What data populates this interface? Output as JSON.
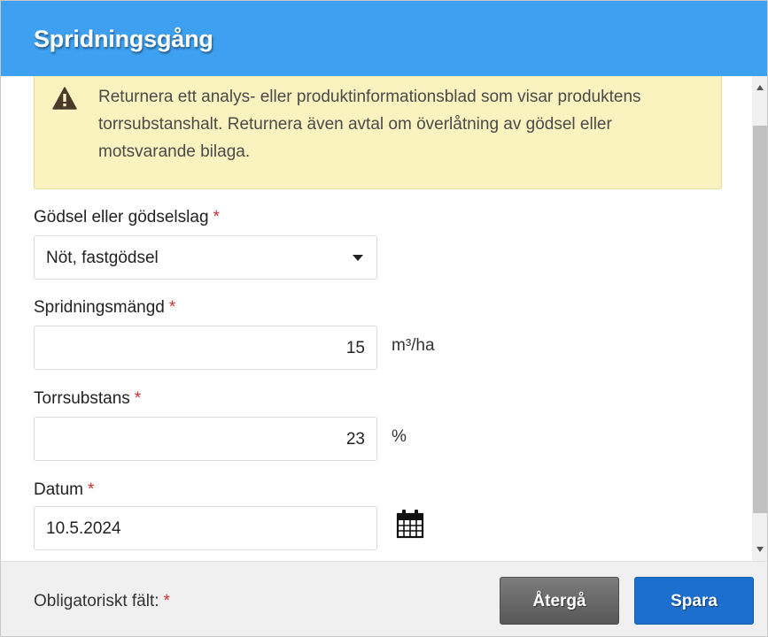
{
  "dialog": {
    "title": "Spridningsgång"
  },
  "warning": {
    "icon": "warning-triangle-icon",
    "text": "Returnera ett analys- eller produktinformationsblad som visar produktens torrsubstanshalt. Returnera även avtal om överlåtning av gödsel eller motsvarande bilaga."
  },
  "fields": {
    "manure_type": {
      "label": "Gödsel eller gödselslag",
      "required_mark": "*",
      "value": "Nöt, fastgödsel"
    },
    "spread_amount": {
      "label": "Spridningsmängd",
      "required_mark": "*",
      "value": "15",
      "unit": "m³/ha"
    },
    "dry_matter": {
      "label": "Torrsubstans",
      "required_mark": "*",
      "value": "23",
      "unit": "%"
    },
    "date": {
      "label": "Datum",
      "required_mark": "*",
      "value": "10.5.2024",
      "icon": "calendar-icon"
    }
  },
  "footer": {
    "required_note": "Obligatoriskt fält:",
    "required_mark": "*",
    "back_label": "Återgå",
    "save_label": "Spara"
  },
  "colors": {
    "header": "#3ea0f0",
    "warning_bg": "#faf3c0",
    "required": "#d32f2f",
    "save_button": "#1c6fcc",
    "back_button": "#6a6a6a"
  }
}
